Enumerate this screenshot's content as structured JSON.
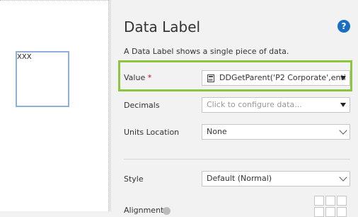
{
  "canvas": {
    "widget_text": "XXX"
  },
  "panel": {
    "title": "Data Label",
    "help_icon": "question-circle-icon",
    "description": "A Data Label shows a single piece of data.",
    "value": {
      "label": "Value",
      "required_mark": "*",
      "field_value": "DDGetParent('P2 Corporate',enti",
      "icon": "calculator-icon"
    },
    "decimals": {
      "label": "Decimals",
      "placeholder": "Click to configure data..."
    },
    "units_location": {
      "label": "Units Location",
      "value": "None"
    },
    "style": {
      "label": "Style",
      "value": "Default (Normal)"
    },
    "alignment": {
      "label": "Alignment"
    }
  },
  "colors": {
    "highlight": "#8cc63f",
    "help": "#1a6fc2",
    "widget_border": "#8fb0d6"
  }
}
